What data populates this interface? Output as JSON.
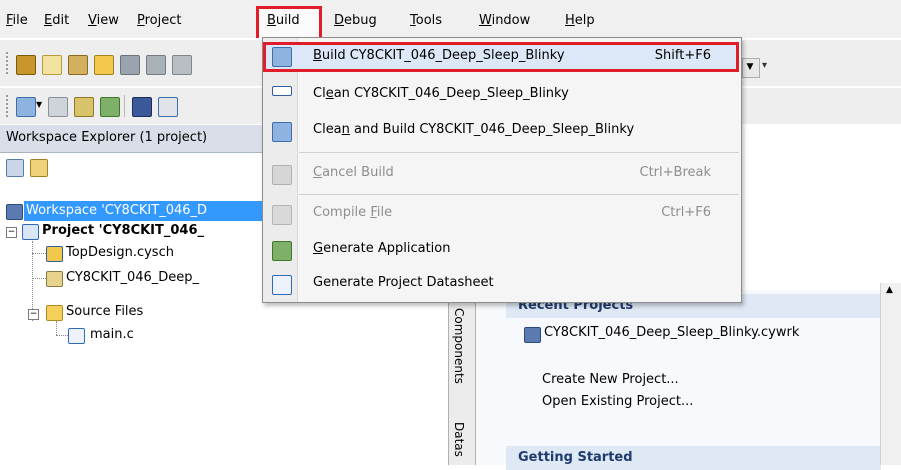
{
  "menubar": {
    "items": [
      {
        "label": "File",
        "key": "F",
        "rest": "ile"
      },
      {
        "label": "Edit",
        "key": "E",
        "rest": "dit"
      },
      {
        "label": "View",
        "key": "V",
        "rest": "iew"
      },
      {
        "label": "Project",
        "key": "P",
        "rest": "roject"
      },
      {
        "label": "Build",
        "key": "B",
        "rest": "uild"
      },
      {
        "label": "Debug",
        "key": "D",
        "rest": "ebug"
      },
      {
        "label": "Tools",
        "key": "T",
        "rest": "ools"
      },
      {
        "label": "Window",
        "key": "W",
        "rest": "indow"
      },
      {
        "label": "Help",
        "key": "H",
        "rest": "elp"
      }
    ]
  },
  "build_menu": {
    "items": [
      {
        "pre": "",
        "key": "B",
        "post": "uild CY8CKIT_046_Deep_Sleep_Blinky",
        "shortcut": "Shift+F6",
        "enabled": true,
        "icon": "build-icon"
      },
      {
        "pre": "Cl",
        "key": "e",
        "post": "an CY8CKIT_046_Deep_Sleep_Blinky",
        "shortcut": "",
        "enabled": true,
        "icon": "clean-icon"
      },
      {
        "pre": "Clea",
        "key": "n",
        "post": " and Build CY8CKIT_046_Deep_Sleep_Blinky",
        "shortcut": "",
        "enabled": true,
        "icon": "clean-build-icon"
      },
      {
        "pre": "",
        "key": "C",
        "post": "ancel Build",
        "shortcut": "Ctrl+Break",
        "enabled": false,
        "icon": "cancel-build-icon"
      },
      {
        "pre": "Compile ",
        "key": "F",
        "post": "ile",
        "shortcut": "Ctrl+F6",
        "enabled": false,
        "icon": "compile-file-icon"
      },
      {
        "pre": "",
        "key": "G",
        "post": "enerate Application",
        "shortcut": "",
        "enabled": true,
        "icon": "generate-application-icon"
      },
      {
        "pre": "Generate Project Datasheet",
        "key": "",
        "post": "",
        "shortcut": "",
        "enabled": true,
        "icon": "datasheet-icon"
      }
    ]
  },
  "workspace_explorer": {
    "title": "Workspace Explorer (1 project)",
    "tree": {
      "workspace": "Workspace 'CY8CKIT_046_D",
      "project": "Project  'CY8CKIT_046_",
      "topdesign": "TopDesign.cysch",
      "cydwr": "CY8CKIT_046_Deep_",
      "source_files": "Source Files",
      "main_c": "main.c"
    }
  },
  "side_tabs": {
    "components": "Components",
    "datasheets": "Datas"
  },
  "start_page": {
    "recent_projects_header": "Recent Projects",
    "recent_project": "CY8CKIT_046_Deep_Sleep_Blinky.cywrk",
    "create_new": "Create New Project...",
    "open_existing": "Open Existing Project...",
    "getting_started_header": "Getting Started"
  },
  "colors": {
    "highlight_border": "#e11d2a",
    "selection": "#3399ff",
    "menu_hover": "#dce8f8"
  }
}
